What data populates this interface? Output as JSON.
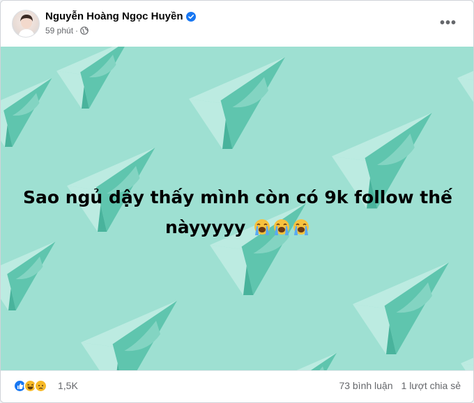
{
  "post": {
    "author_name": "Nguyễn Hoàng Ngọc Huyền",
    "time": "59 phút",
    "separator": "·",
    "text_line1": "Sao ngủ dậy thấy mình còn có 9k follow thế",
    "text_line2": "nàyyyyy",
    "emoji": [
      "crying-face",
      "crying-face",
      "crying-face"
    ]
  },
  "footer": {
    "reaction_count": "1,5K",
    "comments": "73 bình luận",
    "shares": "1 lượt chia sẻ"
  },
  "icons": {
    "verified": "verified-badge-icon",
    "privacy": "globe-icon",
    "more": "more-options-icon",
    "reactions": [
      "like-icon",
      "haha-icon",
      "sad-icon"
    ]
  },
  "colors": {
    "image_background": "#9ee0d2",
    "plane_light": "#bcebe1",
    "plane_dark": "#5fc5ae",
    "verified": "#1877f2",
    "meta_text": "#65676b"
  }
}
